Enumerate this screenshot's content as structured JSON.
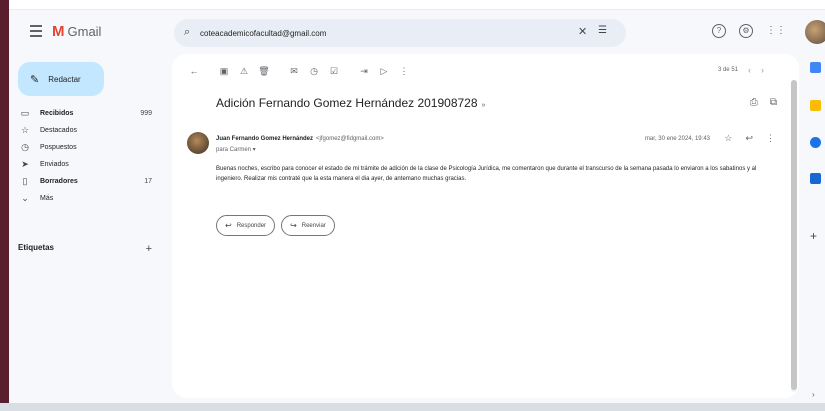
{
  "app": {
    "name": "Gmail"
  },
  "search": {
    "query": "coteacademicofacultad@gmail.com",
    "clear_icon": "close-icon",
    "filter_icon": "tune-icon"
  },
  "compose": {
    "label": "Redactar"
  },
  "nav": {
    "items": [
      {
        "label": "Recibidos",
        "count": "999",
        "icon": "inbox-icon",
        "bold": true
      },
      {
        "label": "Destacados",
        "count": "",
        "icon": "star-icon",
        "bold": false
      },
      {
        "label": "Pospuestos",
        "count": "",
        "icon": "clock-icon",
        "bold": false
      },
      {
        "label": "Enviados",
        "count": "",
        "icon": "send-icon",
        "bold": false
      },
      {
        "label": "Borradores",
        "count": "17",
        "icon": "draft-icon",
        "bold": true
      },
      {
        "label": "Más",
        "count": "",
        "icon": "chevron-down-icon",
        "bold": false
      }
    ],
    "labels_title": "Etiquetas"
  },
  "toolbar": {
    "pagination": "3 de 51"
  },
  "email": {
    "subject": "Adición Fernando Gomez Hernández 201908728",
    "subject_label": "»",
    "sender_name": "Juan Fernando Gomez Hernández",
    "sender_email": "<jfgomez@fidgmail.com>",
    "to": "para Carmen ▾",
    "date": "mar, 30 ene 2024, 19:43",
    "body": "Buenas noches, escribo para conocer el estado de mi trámite de adición de la clase de Psicología Jurídica, me comentaron que durante el transcurso de la semana pasada lo enviaron a los sabatinos y al ingeniero. Realizar mis contraté que la esta manera el dia ayer, de antemano muchas gracias."
  },
  "reply": {
    "reply_label": "Responder",
    "forward_label": "Reenviar"
  },
  "colors": {
    "compose_bg": "#c2e7ff",
    "accent": "#0b57d0",
    "gmail_red": "#ea4335"
  }
}
